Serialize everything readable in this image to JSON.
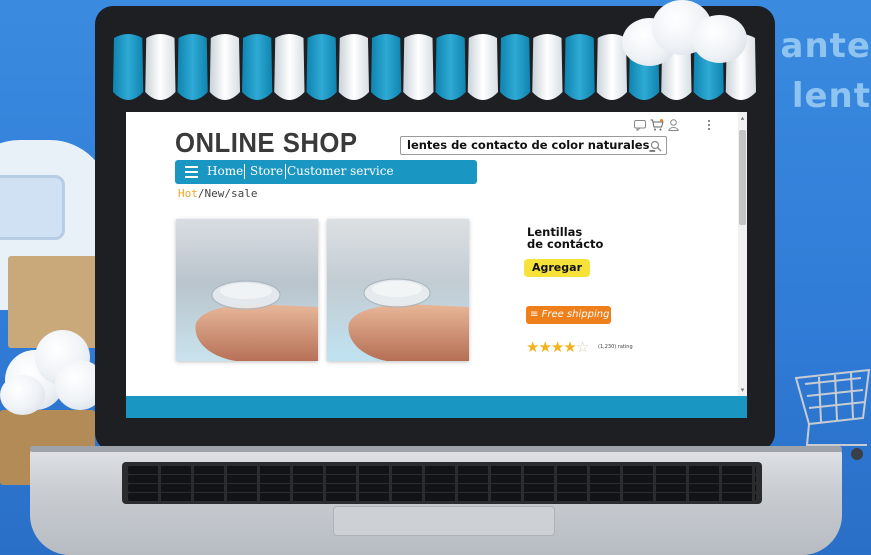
{
  "scene": {
    "bg_line1": "ante",
    "bg_line2": "lent"
  },
  "shop": {
    "brand": "ONLINE SHOP",
    "search_value": "lentes de contacto de color naturales_",
    "nav": {
      "home": "Home",
      "store": "Store",
      "customer_service": "Customer service"
    },
    "breadcrumb": {
      "hot": "Hot",
      "rest": "/New/sale"
    },
    "product": {
      "title_line1": "Lentillas",
      "title_line2": "de contácto",
      "add_label": "Agregar",
      "shipping_label": "Free shipping",
      "rating_stars": 4,
      "rating_max": 5,
      "rating_text": "(1,230) rating"
    },
    "icons": {
      "chat": "chat-icon",
      "cart": "cart-icon",
      "user": "user-icon",
      "search": "search-icon",
      "menu": "hamburger-menu-icon",
      "more": "kebab-menu-icon"
    },
    "colors": {
      "accent": "#1a96c2",
      "add_button": "#f7e23a",
      "shipping_button": "#ef7f1a",
      "hot": "#f5a623",
      "stars": "#f2b21b"
    }
  }
}
